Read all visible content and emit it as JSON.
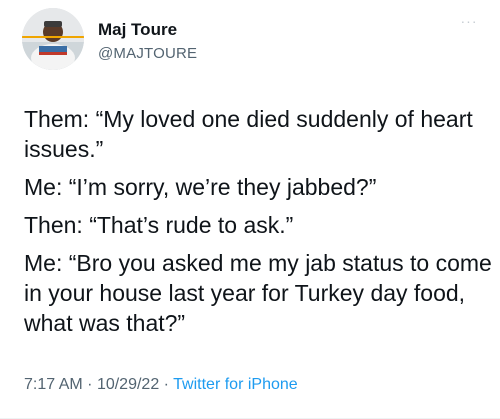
{
  "user": {
    "display_name": "Maj Toure",
    "handle": "@MAJTOURE",
    "avatar_icon": "profile-photo-avatar"
  },
  "header": {
    "more_icon": "more-horizontal-icon",
    "more_glyph": "···"
  },
  "tweet": {
    "paragraphs": [
      "Them: “My loved one died suddenly of heart issues.”",
      "Me: “I’m sorry, we’re they jabbed?”",
      "Then: “That’s rude to ask.”",
      "Me: “Bro you asked me my jab status to come in your house last year for Turkey day food, what was that?”"
    ]
  },
  "meta": {
    "time": "7:17 AM",
    "separator": "·",
    "date": "10/29/22",
    "source": "Twitter for iPhone"
  },
  "colors": {
    "text": "#0f1419",
    "secondary": "#536471",
    "link": "#1d9bf0"
  }
}
